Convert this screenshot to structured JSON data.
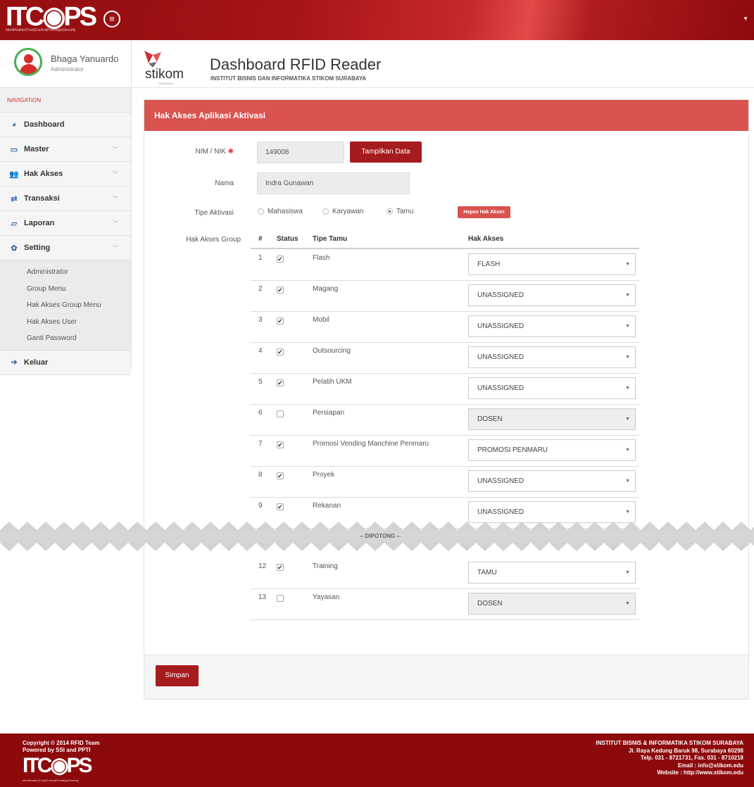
{
  "brand": {
    "logo_text": "ITC◉PS",
    "tagline": "Identification|Trust|Control|Previlege|Security"
  },
  "user": {
    "name": "Bhaga Yanuardo",
    "role": "Administrator"
  },
  "nav": {
    "label": "NAVIGATION",
    "items": [
      {
        "label": "Dashboard",
        "icon": "dashboard-icon"
      },
      {
        "label": "Master",
        "icon": "monitor-icon"
      },
      {
        "label": "Hak Akses",
        "icon": "users-icon"
      },
      {
        "label": "Transaksi",
        "icon": "exchange-icon"
      },
      {
        "label": "Laporan",
        "icon": "folder-icon"
      },
      {
        "label": "Setting",
        "icon": "gear-icon"
      },
      {
        "label": "Keluar",
        "icon": "sign-out-icon"
      }
    ],
    "setting_sub": [
      "Administrator",
      "Group Menu",
      "Hak Akses Group Menu",
      "Hak Akses User",
      "Ganti Password"
    ]
  },
  "header": {
    "logo_word": "stikom",
    "logo_small": "SURABAYA",
    "title": "Dashboard RFID Reader",
    "subtitle": "INSTITUT BISNIS DAN INFORMATIKA STIKOM SURABAYA"
  },
  "panel": {
    "title": "Hak Akses Aplikasi Aktivasi",
    "nim_label": "NIM / NIK",
    "nim_value": "149008",
    "show_button": "Tampilkan Data",
    "nama_label": "Nama",
    "nama_value": "Indra Gunawan",
    "tipe_label": "Tipe Aktivasi",
    "tipe_options": [
      "Mahasiswa",
      "Karyawan",
      "Tamu"
    ],
    "tipe_selected": "Tamu",
    "hapus_button": "Hapus Hak Akses",
    "group_label": "Hak Akses Group",
    "table_headers": [
      "#",
      "Status",
      "Tipe Tamu",
      "Hak Akses"
    ],
    "rows": [
      {
        "no": "1",
        "checked": true,
        "tipe": "Flash",
        "akses": "FLASH",
        "disabled": false
      },
      {
        "no": "2",
        "checked": true,
        "tipe": "Magang",
        "akses": "UNASSIGNED",
        "disabled": false
      },
      {
        "no": "3",
        "checked": true,
        "tipe": "Mobil",
        "akses": "UNASSIGNED",
        "disabled": false
      },
      {
        "no": "4",
        "checked": true,
        "tipe": "Outsourcing",
        "akses": "UNASSIGNED",
        "disabled": false
      },
      {
        "no": "5",
        "checked": true,
        "tipe": "Pelatih UKM",
        "akses": "UNASSIGNED",
        "disabled": false
      },
      {
        "no": "6",
        "checked": false,
        "tipe": "Persiapan",
        "akses": "DOSEN",
        "disabled": true
      },
      {
        "no": "7",
        "checked": true,
        "tipe": "Promosi Vending Manchine Penmaru",
        "akses": "PROMOSI PENMARU",
        "disabled": false
      },
      {
        "no": "8",
        "checked": true,
        "tipe": "Proyek",
        "akses": "UNASSIGNED",
        "disabled": false
      },
      {
        "no": "9",
        "checked": true,
        "tipe": "Rekanan",
        "akses": "UNASSIGNED",
        "disabled": false
      },
      {
        "no": "12",
        "checked": true,
        "tipe": "Training",
        "akses": "TAMU",
        "disabled": false
      },
      {
        "no": "13",
        "checked": false,
        "tipe": "Yayasan",
        "akses": "DOSEN",
        "disabled": true
      }
    ],
    "cut_label": "-- DIPOTONG --",
    "save_button": "Simpan"
  },
  "footer": {
    "copyright": "Copyright © 2014 RFID Team",
    "powered": "Powered by SSI and PPTI",
    "logo_text": "ITC◉PS",
    "tagline": "Identification|Trust|Control|Previlege|Security",
    "org": "INSTITUT BISNIS & INFORMATIKA STIKOM SURABAYA",
    "address": "Jl. Raya Kedung Baruk 98, Surabaya 60298",
    "phone": "Telp. 031 - 8721731, Fax. 031 - 8710218",
    "email": "Email : info@stikom.edu",
    "website": "Website : http://www.stikom.edu"
  },
  "colors": {
    "brand_red": "#980f12",
    "panel_header": "#d9534f",
    "button": "#a61b1e"
  }
}
